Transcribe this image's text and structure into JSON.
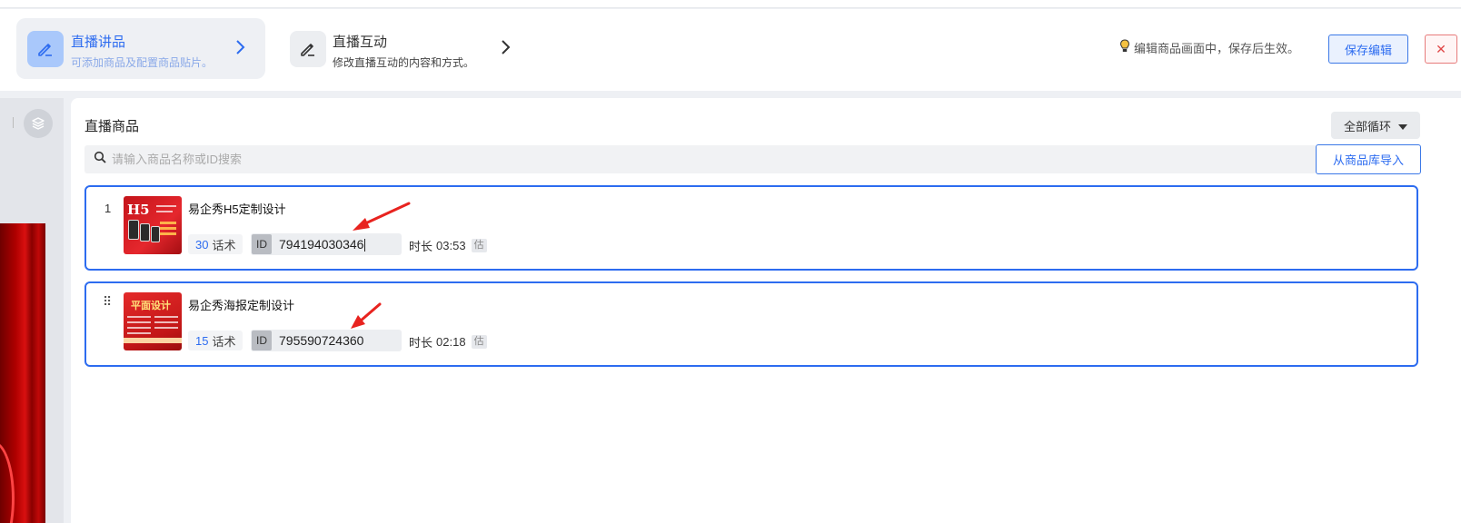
{
  "steps": [
    {
      "title": "直播讲品",
      "subtitle": "可添加商品及配置商品贴片。",
      "state": "active"
    },
    {
      "title": "直播互动",
      "subtitle": "修改直播互动的内容和方式。",
      "state": "inactive"
    }
  ],
  "header": {
    "tip": "编辑商品画面中，保存后生效。",
    "save_label": "保存编辑",
    "close_symbol": "✕"
  },
  "main": {
    "title": "直播商品",
    "loop_select": "全部循环",
    "search_placeholder": "请输入商品名称或ID搜索",
    "import_label": "从商品库导入"
  },
  "products": [
    {
      "index": "1",
      "name": "易企秀H5定制设计",
      "script_count": "30",
      "script_label": "话术",
      "id_tag": "ID",
      "id_value": "794194030346",
      "duration_label": "时长",
      "duration": "03:53",
      "estimate": "估",
      "thumb_text": "H5"
    },
    {
      "index": "⠿",
      "name": "易企秀海报定制设计",
      "script_count": "15",
      "script_label": "话术",
      "id_tag": "ID",
      "id_value": "795590724360",
      "duration_label": "时长",
      "duration": "02:18",
      "estimate": "估",
      "thumb_text": "平面设计"
    }
  ],
  "colors": {
    "accent": "#2d6cf0",
    "danger": "#e04848",
    "annotation_arrow": "#e8231f"
  }
}
